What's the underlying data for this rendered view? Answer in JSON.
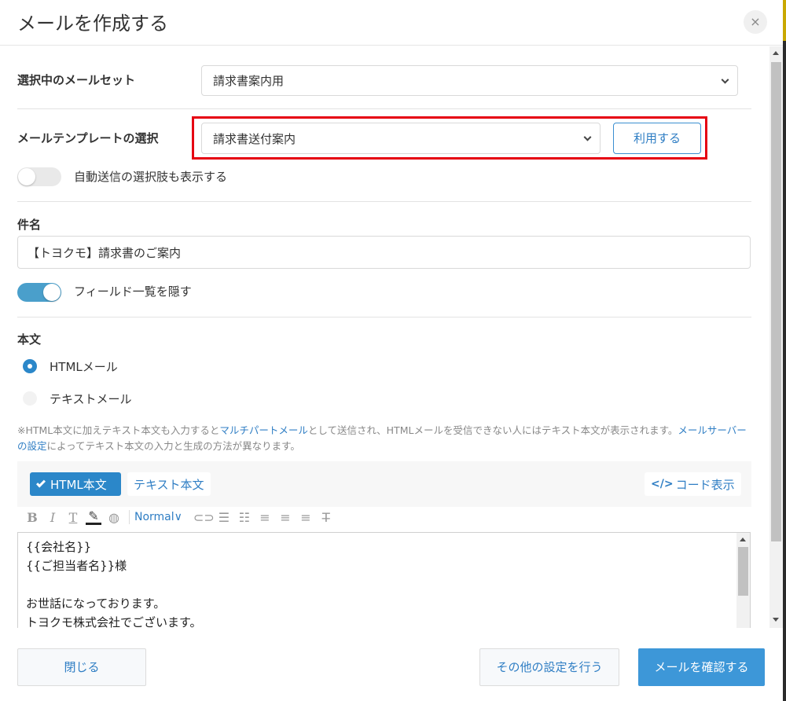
{
  "dialog": {
    "title": "メールを作成する",
    "close_label": "×"
  },
  "mailset": {
    "label": "選択中のメールセット",
    "value": "請求書案内用"
  },
  "template": {
    "label": "メールテンプレートの選択",
    "value": "請求書送付案内",
    "use_button": "利用する"
  },
  "auto_send_toggle": {
    "label": "自動送信の選択肢も表示する",
    "checked": false
  },
  "subject": {
    "label": "件名",
    "value": "【トヨクモ】請求書のご案内"
  },
  "field_list_toggle": {
    "label": "フィールド一覧を隠す",
    "checked": true
  },
  "body": {
    "label": "本文",
    "format_options": [
      {
        "label": "HTMLメール",
        "checked": true
      },
      {
        "label": "テキストメール",
        "checked": false
      }
    ],
    "note": {
      "part1": "※HTML本文に加えテキスト本文も入力すると",
      "link1": "マルチパートメール",
      "part2": "として送信され、HTMLメールを受信できない人にはテキスト本文が表示されます。",
      "link2": "メールサーバーの設定",
      "part3": "によってテキスト本文の入力と生成の方法が異なります。"
    },
    "tabs": {
      "html": "HTML本文",
      "text": "テキスト本文",
      "code": "コード表示"
    },
    "toolbar": {
      "bold": "B",
      "italic": "I",
      "text_style": "T",
      "format_select": "Normal"
    },
    "content_lines": [
      "{{会社名}}",
      "{{ご担当者名}}様",
      "",
      "お世話になっております。",
      "トヨクモ株式会社でございます。"
    ]
  },
  "footer": {
    "close": "閉じる",
    "other_settings": "その他の設定を行う",
    "confirm": "メールを確認する"
  },
  "colors": {
    "accent": "#2b87c9",
    "highlight_border": "#e60012",
    "confirm_button": "#3d97d8"
  }
}
